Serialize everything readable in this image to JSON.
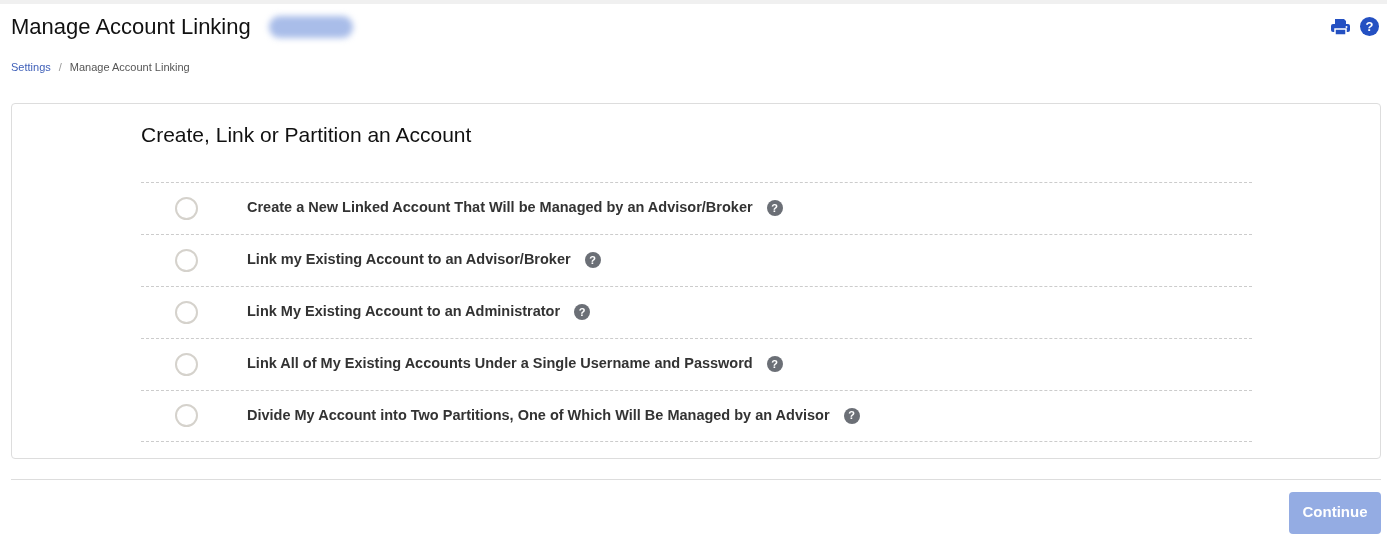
{
  "header": {
    "title": "Manage Account Linking",
    "account_badge": {
      "blurred": true
    },
    "actions": [
      {
        "kind": "print"
      },
      {
        "kind": "help",
        "label": "?"
      }
    ]
  },
  "breadcrumb": [
    {
      "label": "Settings",
      "link": true
    },
    {
      "label": "Manage Account Linking",
      "link": false
    }
  ],
  "breadcrumb_separator": "/",
  "panel": {
    "heading": "Create, Link or Partition an Account",
    "options": [
      {
        "label": "Create a New Linked Account That Will be Managed by an Advisor/Broker",
        "selected": false,
        "help": "?"
      },
      {
        "label": "Link my Existing Account to an Advisor/Broker",
        "selected": false,
        "help": "?"
      },
      {
        "label": "Link My Existing Account to an Administrator",
        "selected": false,
        "help": "?"
      },
      {
        "label": "Link All of My Existing Accounts Under a Single Username and Password",
        "selected": false,
        "help": "?"
      },
      {
        "label": "Divide My Account into Two Partitions, One of Which Will Be Managed by an Advisor",
        "selected": false,
        "help": "?"
      }
    ]
  },
  "footer": {
    "button": {
      "label": "Continue",
      "disabled": true
    }
  }
}
